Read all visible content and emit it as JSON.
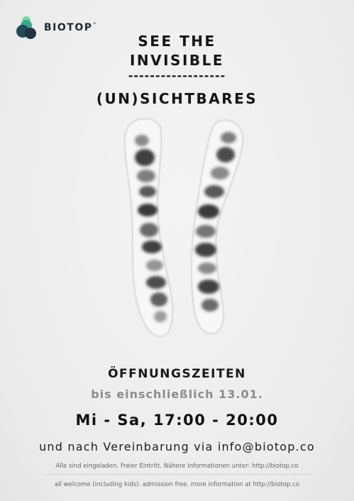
{
  "brand": {
    "name": "BIOTOP",
    "mark": "°",
    "icon": "biotop-logo-icon"
  },
  "headline": {
    "line1": "SEE THE",
    "line2": "INVISIBLE",
    "divider": "------------------",
    "line3": "(UN)SICHTBARES"
  },
  "image": {
    "subject": "chromosome-pair-icon"
  },
  "opening": {
    "title": "ÖFFNUNGSZEITEN",
    "until": "bis einschließlich 13.01.",
    "hours": "Mi - Sa, 17:00 - 20:00",
    "appointment": "und nach Vereinbarung via info@biotop.co"
  },
  "footer": {
    "german": "Alle sind eingeladen. Freier Eintritt. Nähere Informationen unter: http://biotop.co",
    "english": "all welcome (including kids). admission free. more information at http://biotop.co"
  },
  "colors": {
    "background": "#efefef",
    "text": "#1c1c1c",
    "muted": "#8c8c8c",
    "logo_dark": "#1f3340",
    "logo_teal": "#2f6f6a",
    "logo_green": "#58b98b"
  }
}
